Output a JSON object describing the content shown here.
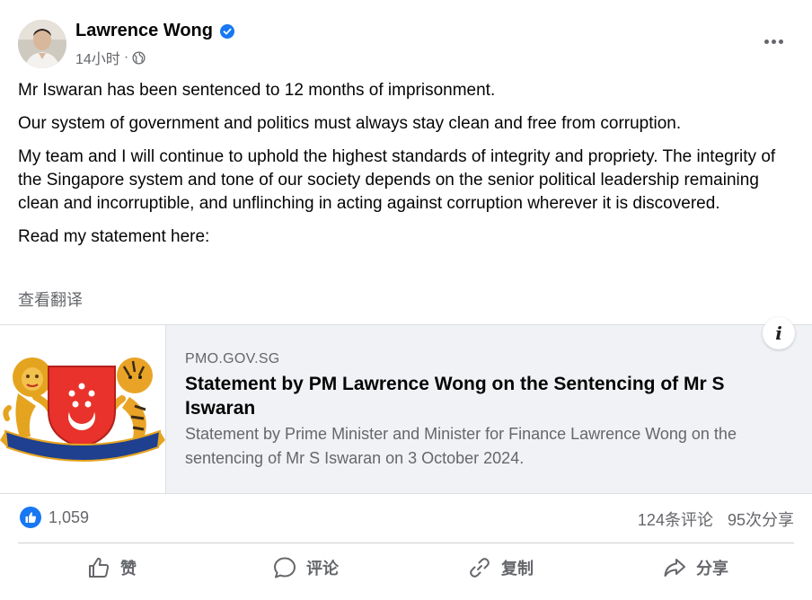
{
  "post": {
    "author": "Lawrence Wong",
    "time": "14小时",
    "separator": "·",
    "paragraphs": [
      "Mr Iswaran has been sentenced to 12 months of imprisonment.",
      "Our system of government and politics must always stay clean and free from corruption.",
      "My team and I will continue to uphold the highest standards of integrity and propriety. The integrity of the Singapore system and tone of our society depends on the senior political leadership remaining clean and incorruptible, and unflinching in acting against corruption wherever it is discovered.",
      "Read my statement here:"
    ],
    "translate": "查看翻译"
  },
  "card": {
    "domain": "PMO.GOV.SG",
    "title": "Statement by PM Lawrence Wong on the Sentencing of Mr S Iswaran",
    "description": "Statement by Prime Minister and Minister for Finance Lawrence Wong on the sentencing of Mr S Iswaran on 3 October 2024.",
    "image_motto": "MAJULAH SINGAPURA",
    "info_icon": "info-icon"
  },
  "stats": {
    "likes": "1,059",
    "comments": "124条评论",
    "shares": "95次分享"
  },
  "actions": {
    "like": "赞",
    "comment": "评论",
    "copy": "复制",
    "share": "分享"
  },
  "colors": {
    "accent_blue": "#1877f2",
    "muted_text": "#65676b",
    "card_bg": "#f0f2f5",
    "crest_red": "#e8322b",
    "crest_gold": "#e5a41f"
  }
}
